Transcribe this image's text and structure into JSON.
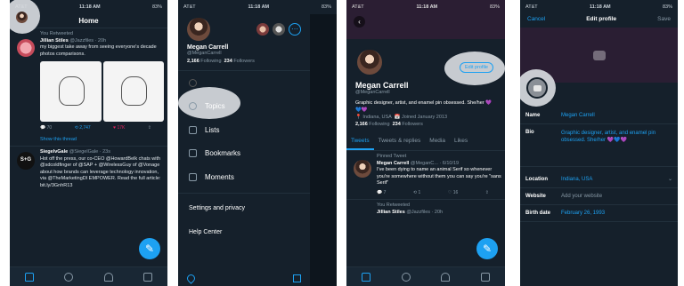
{
  "status": {
    "carrier": "AT&T",
    "time": "11:18 AM",
    "battery": "83%"
  },
  "home": {
    "title": "Home",
    "tweet1": {
      "context": "You Retweeted",
      "name": "Jillian Stiles",
      "handle": "@Jazzfiles · 20h",
      "text": "my biggest take away from seeing everyone's decade photos comparisons.",
      "show_thread": "Show this thread",
      "counts": [
        "70",
        "2,747",
        "17K"
      ]
    },
    "tweet2": {
      "name": "SiegelvGale",
      "handle": "@SiegelGale · 23s",
      "text": "Hot off the press, our co-CEO @HowardBelk chats with @sdcoldfinger of @SAP + @WirelessGuy of @Vonage about how brands can leverage technology innovation, via @TheMarketingDI EMPOWER. Read the full article: bit.ly/3GnhR13",
      "avatar_text": "S+G"
    }
  },
  "drawer": {
    "name": "Megan Carrell",
    "handle": "@MeganCarrell",
    "following_count": "2,166",
    "following_label": "Following",
    "followers_count": "234",
    "followers_label": "Followers",
    "items": [
      "Profile",
      "Topics",
      "Lists",
      "Bookmarks",
      "Moments"
    ],
    "settings": "Settings and privacy",
    "help": "Help Center"
  },
  "profile": {
    "edit_button": "Edit profile",
    "name": "Megan Carrell",
    "handle": "@MeganCarrell",
    "bio": "Graphic designer, artist, and enamel pin obsessed. She/her 💜💙💜",
    "location": "Indiana, USA",
    "joined": "Joined January 2013",
    "following_count": "2,166",
    "following_label": "Following",
    "followers_count": "234",
    "followers_label": "Followers",
    "tabs": [
      "Tweets",
      "Tweets & replies",
      "Media",
      "Likes"
    ],
    "pinned_label": "Pinned Tweet",
    "pinned_name": "Megan Carrell",
    "pinned_handle": "@MeganC... · 6/10/19",
    "pinned_text": "I've been dying to name an animal Serif so whenever you're somewhere without them you can say you're \"sans Serif\"",
    "pinned_counts": [
      "7",
      "1",
      "16"
    ],
    "retweet_label": "You Retweeted",
    "retweet_name": "Jillian Stiles",
    "retweet_handle": "@Jazzfiles · 20h"
  },
  "edit": {
    "cancel": "Cancel",
    "title": "Edit profile",
    "save": "Save",
    "name_label": "Name",
    "name_value": "Megan Carrell",
    "bio_label": "Bio",
    "bio_value": "Graphic designer, artist, and enamel pin obsessed. She/her 💜💙💜",
    "location_label": "Location",
    "location_value": "Indiana, USA",
    "website_label": "Website",
    "website_placeholder": "Add your website",
    "birth_label": "Birth date",
    "birth_value": "February 26, 1993"
  },
  "colors": {
    "accent": "#1da1f2",
    "background": "#15202b",
    "heart": "#e0245e",
    "highlight": "#d7dade"
  }
}
